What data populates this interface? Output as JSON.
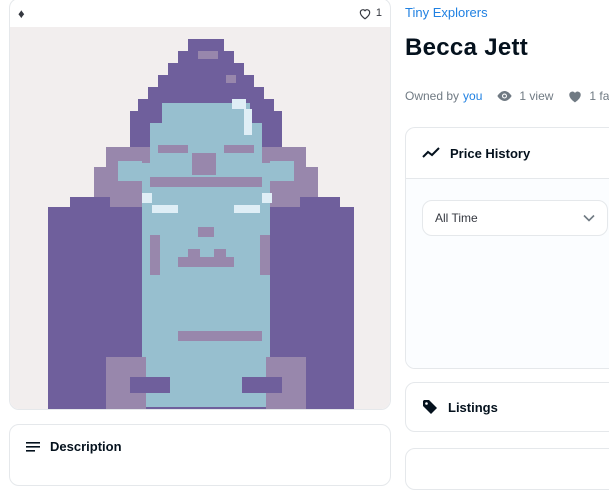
{
  "asset": {
    "currency_symbol": "♦",
    "favorites_count": "1"
  },
  "collection": {
    "name": "Tiny Explorers"
  },
  "title": "Becca Jett",
  "ownership": {
    "owned_by_label": "Owned by",
    "owner": "you",
    "views": "1 view",
    "favorites": "1 fa"
  },
  "price_history": {
    "title": "Price History",
    "filter_value": "All Time"
  },
  "listings": {
    "title": "Listings"
  },
  "description": {
    "title": "Description"
  },
  "colors": {
    "accent": "#2081e2",
    "art_background": "#f2eeee",
    "art_purple": "#6f5f9c",
    "art_grey_purple": "#9887ac",
    "art_face": "#97bfcf",
    "art_highlight": "#dfeef6"
  },
  "icons": {
    "currency": "ethereum-icon",
    "favorite": "heart-outline-icon",
    "views": "eye-icon",
    "favorites_meta": "heart-filled-icon",
    "price_history": "trend-line-icon",
    "filter": "chevron-down-icon",
    "listings": "tag-icon",
    "description": "lines-icon"
  }
}
